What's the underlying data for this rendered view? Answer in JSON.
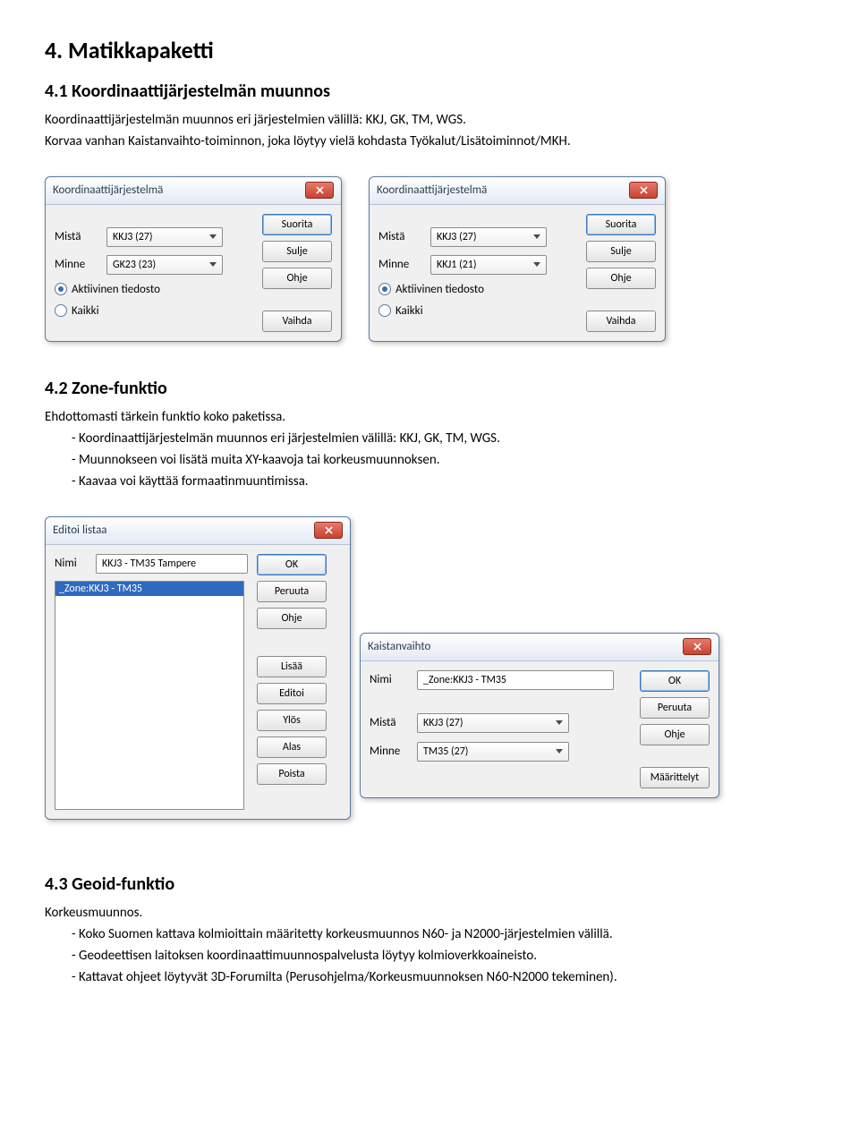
{
  "h1": "4. Matikkapaketti",
  "s41": {
    "title": "4.1 Koordinaattijärjestelmän muunnos",
    "p1": "Koordinaattijärjestelmän muunnos eri järjestelmien välillä: KKJ, GK, TM, WGS.",
    "p2": "Korvaa vanhan Kaistanvaihto-toiminnon, joka löytyy vielä kohdasta Työkalut/Lisätoiminnot/MKH."
  },
  "dlg1": {
    "title": "Koordinaattijärjestelmä",
    "from_label": "Mistä",
    "to_label": "Minne",
    "from_value": "KKJ3   (27)",
    "to_value": "GK23   (23)",
    "radio1": "Aktiivinen tiedosto",
    "radio2": "Kaikki",
    "btn_run": "Suorita",
    "btn_close": "Sulje",
    "btn_help": "Ohje",
    "btn_swap": "Vaihda"
  },
  "dlg2": {
    "title": "Koordinaattijärjestelmä",
    "from_label": "Mistä",
    "to_label": "Minne",
    "from_value": "KKJ3   (27)",
    "to_value": "KKJ1   (21)",
    "radio1": "Aktiivinen tiedosto",
    "radio2": "Kaikki",
    "btn_run": "Suorita",
    "btn_close": "Sulje",
    "btn_help": "Ohje",
    "btn_swap": "Vaihda"
  },
  "s42": {
    "title": "4.2 Zone-funktio",
    "p1": "Ehdottomasti tärkein funktio koko paketissa.",
    "b1": "- Koordinaattijärjestelmän muunnos eri järjestelmien välillä: KKJ, GK, TM, WGS.",
    "b2": "- Muunnokseen voi lisätä muita XY-kaavoja tai korkeusmuunnoksen.",
    "b3": "- Kaavaa voi käyttää formaatinmuuntimissa."
  },
  "dlg3": {
    "title": "Editoi listaa",
    "name_label": "Nimi",
    "name_value": "KKJ3 - TM35 Tampere",
    "list_item": "_Zone:KKJ3 - TM35",
    "btn_ok": "OK",
    "btn_cancel": "Peruuta",
    "btn_help": "Ohje",
    "btn_add": "Lisää",
    "btn_edit": "Editoi",
    "btn_up": "Ylös",
    "btn_down": "Alas",
    "btn_del": "Poista"
  },
  "dlg4": {
    "title": "Kaistanvaihto",
    "name_label": "Nimi",
    "name_value": "_Zone:KKJ3 - TM35",
    "from_label": "Mistä",
    "to_label": "Minne",
    "from_value": "KKJ3   (27)",
    "to_value": "TM35   (27)",
    "btn_ok": "OK",
    "btn_cancel": "Peruuta",
    "btn_help": "Ohje",
    "btn_def": "Määrittelyt"
  },
  "s43": {
    "title": "4.3 Geoid-funktio",
    "p1": "Korkeusmuunnos.",
    "b1": "- Koko Suomen kattava kolmioittain määritetty korkeusmuunnos N60- ja N2000-järjestelmien välillä.",
    "b2": "- Geodeettisen laitoksen koordinaattimuunnospalvelusta löytyy kolmioverkkoaineisto.",
    "b3": "- Kattavat ohjeet löytyvät 3D-Forumilta (Perusohjelma/Korkeusmuunnoksen N60-N2000 tekeminen)."
  }
}
